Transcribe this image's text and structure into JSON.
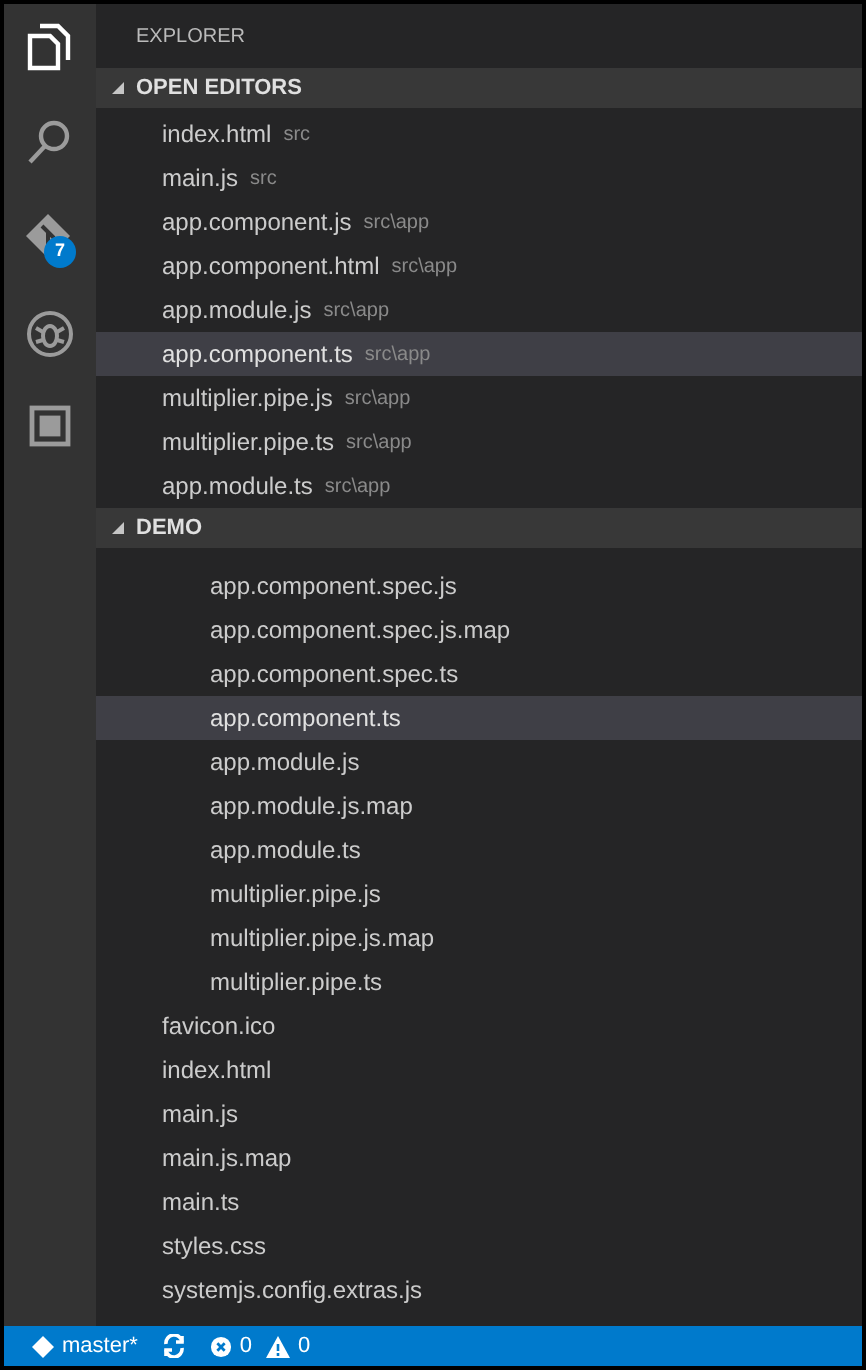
{
  "activity_bar": {
    "scm_badge": "7"
  },
  "explorer": {
    "title": "EXPLORER"
  },
  "open_editors": {
    "title": "OPEN EDITORS",
    "expanded": true,
    "items": [
      {
        "label": "index.html",
        "path": "src",
        "selected": false
      },
      {
        "label": "main.js",
        "path": "src",
        "selected": false
      },
      {
        "label": "app.component.js",
        "path": "src\\app",
        "selected": false
      },
      {
        "label": "app.component.html",
        "path": "src\\app",
        "selected": false
      },
      {
        "label": "app.module.js",
        "path": "src\\app",
        "selected": false
      },
      {
        "label": "app.component.ts",
        "path": "src\\app",
        "selected": true
      },
      {
        "label": "multiplier.pipe.js",
        "path": "src\\app",
        "selected": false
      },
      {
        "label": "multiplier.pipe.ts",
        "path": "src\\app",
        "selected": false
      },
      {
        "label": "app.module.ts",
        "path": "src\\app",
        "selected": false
      }
    ]
  },
  "demo": {
    "title": "DEMO",
    "expanded": true,
    "items": [
      {
        "children": [
          {
            "label": "app.component.spec.js",
            "selected": false
          },
          {
            "label": "app.component.spec.js.map",
            "selected": false
          },
          {
            "label": "app.component.spec.ts",
            "selected": false
          },
          {
            "label": "app.component.ts",
            "selected": true
          },
          {
            "label": "app.module.js",
            "selected": false
          },
          {
            "label": "app.module.js.map",
            "selected": false
          },
          {
            "label": "app.module.ts",
            "selected": false
          },
          {
            "label": "multiplier.pipe.js",
            "selected": false
          },
          {
            "label": "multiplier.pipe.js.map",
            "selected": false
          },
          {
            "label": "multiplier.pipe.ts",
            "selected": false
          }
        ]
      },
      {
        "label": "favicon.ico",
        "selected": false
      },
      {
        "label": "index.html",
        "selected": false
      },
      {
        "label": "main.js",
        "selected": false
      },
      {
        "label": "main.js.map",
        "selected": false
      },
      {
        "label": "main.ts",
        "selected": false
      },
      {
        "label": "styles.css",
        "selected": false
      },
      {
        "label": "systemjs.config.extras.js",
        "selected": false
      }
    ]
  },
  "status_bar": {
    "branch": "master*",
    "errors": "0",
    "warnings": "0"
  }
}
